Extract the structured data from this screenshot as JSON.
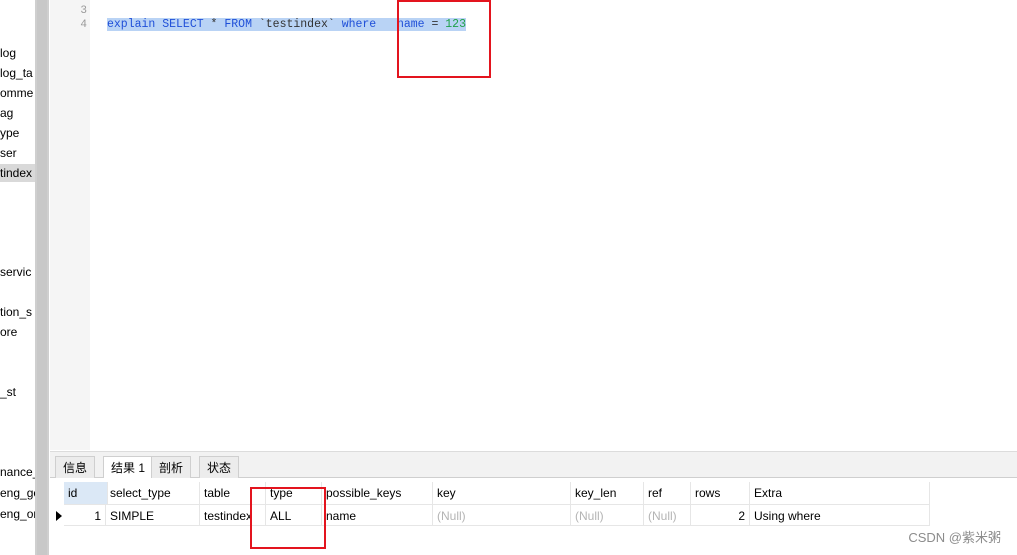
{
  "sidebar": {
    "items": [
      {
        "label": "log"
      },
      {
        "label": "log_ta"
      },
      {
        "label": "omme"
      },
      {
        "label": "ag"
      },
      {
        "label": "ype"
      },
      {
        "label": "ser"
      },
      {
        "label": "tindex",
        "selected": true
      },
      {
        "label": "servic"
      },
      {
        "label": "tion_s"
      },
      {
        "label": "ore"
      },
      {
        "label": "_st"
      },
      {
        "label": "nance_"
      },
      {
        "label": "eng_gc"
      },
      {
        "label": "eng_or"
      }
    ]
  },
  "editor": {
    "line_numbers": [
      "3",
      "4"
    ],
    "query": {
      "kw1": "explain",
      "kw2": "SELECT",
      "star": "*",
      "kw3": "FROM",
      "table": "`testindex`",
      "kw4": "where",
      "field": "name",
      "eq": "=",
      "value": "123"
    }
  },
  "tabs": [
    {
      "label": "信息",
      "active": false
    },
    {
      "label": "结果 1",
      "active": true
    },
    {
      "label": "剖析",
      "active": false
    },
    {
      "label": "状态",
      "active": false
    }
  ],
  "grid": {
    "columns": [
      "id",
      "select_type",
      "table",
      "type",
      "possible_keys",
      "key",
      "key_len",
      "ref",
      "rows",
      "Extra"
    ],
    "rows": [
      [
        "1",
        "SIMPLE",
        "testindex",
        "ALL",
        "name",
        "(Null)",
        "(Null)",
        "(Null)",
        "2",
        "Using where"
      ]
    ]
  },
  "watermark": "CSDN @紫米粥",
  "colors": {
    "highlight_box": "#e3141e",
    "selection": "#b9d3f5",
    "keyword": "#1f4fd8",
    "number": "#20a04a"
  }
}
